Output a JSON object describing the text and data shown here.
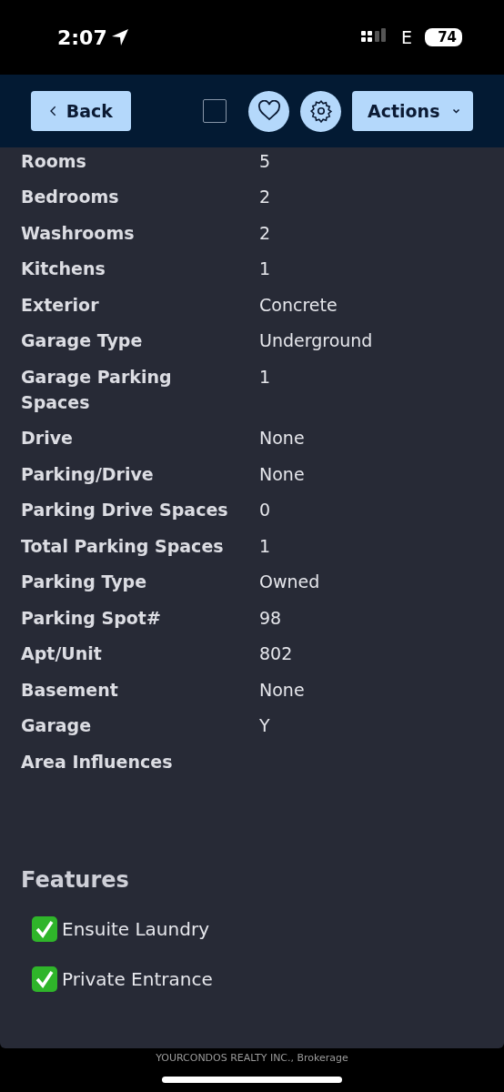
{
  "status_bar": {
    "time": "2:07",
    "network": "E",
    "battery": "74"
  },
  "header": {
    "back": "Back",
    "select_checked": false,
    "actions": "Actions"
  },
  "details": [
    {
      "label": "Rooms",
      "value": "5"
    },
    {
      "label": "Bedrooms",
      "value": "2"
    },
    {
      "label": "Washrooms",
      "value": "2"
    },
    {
      "label": "Kitchens",
      "value": "1"
    },
    {
      "label": "Exterior",
      "value": "Concrete"
    },
    {
      "label": "Garage Type",
      "value": "Underground"
    },
    {
      "label": "Garage Parking Spaces",
      "value": "1"
    },
    {
      "label": "Drive",
      "value": "None"
    },
    {
      "label": "Parking/Drive",
      "value": "None"
    },
    {
      "label": "Parking Drive Spaces",
      "value": "0"
    },
    {
      "label": "Total Parking Spaces",
      "value": "1"
    },
    {
      "label": "Parking Type",
      "value": "Owned"
    },
    {
      "label": "Parking Spot#",
      "value": "98"
    },
    {
      "label": "Apt/Unit",
      "value": "802"
    },
    {
      "label": "Basement",
      "value": "None"
    },
    {
      "label": "Garage",
      "value": "Y"
    },
    {
      "label": "Area Influences"
    }
  ],
  "features": {
    "title": "Features",
    "items": [
      {
        "label": "Ensuite Laundry",
        "checked": true
      },
      {
        "label": "Private Entrance",
        "checked": true
      }
    ]
  },
  "footer": "YOURCONDOS REALTY INC., Brokerage"
}
